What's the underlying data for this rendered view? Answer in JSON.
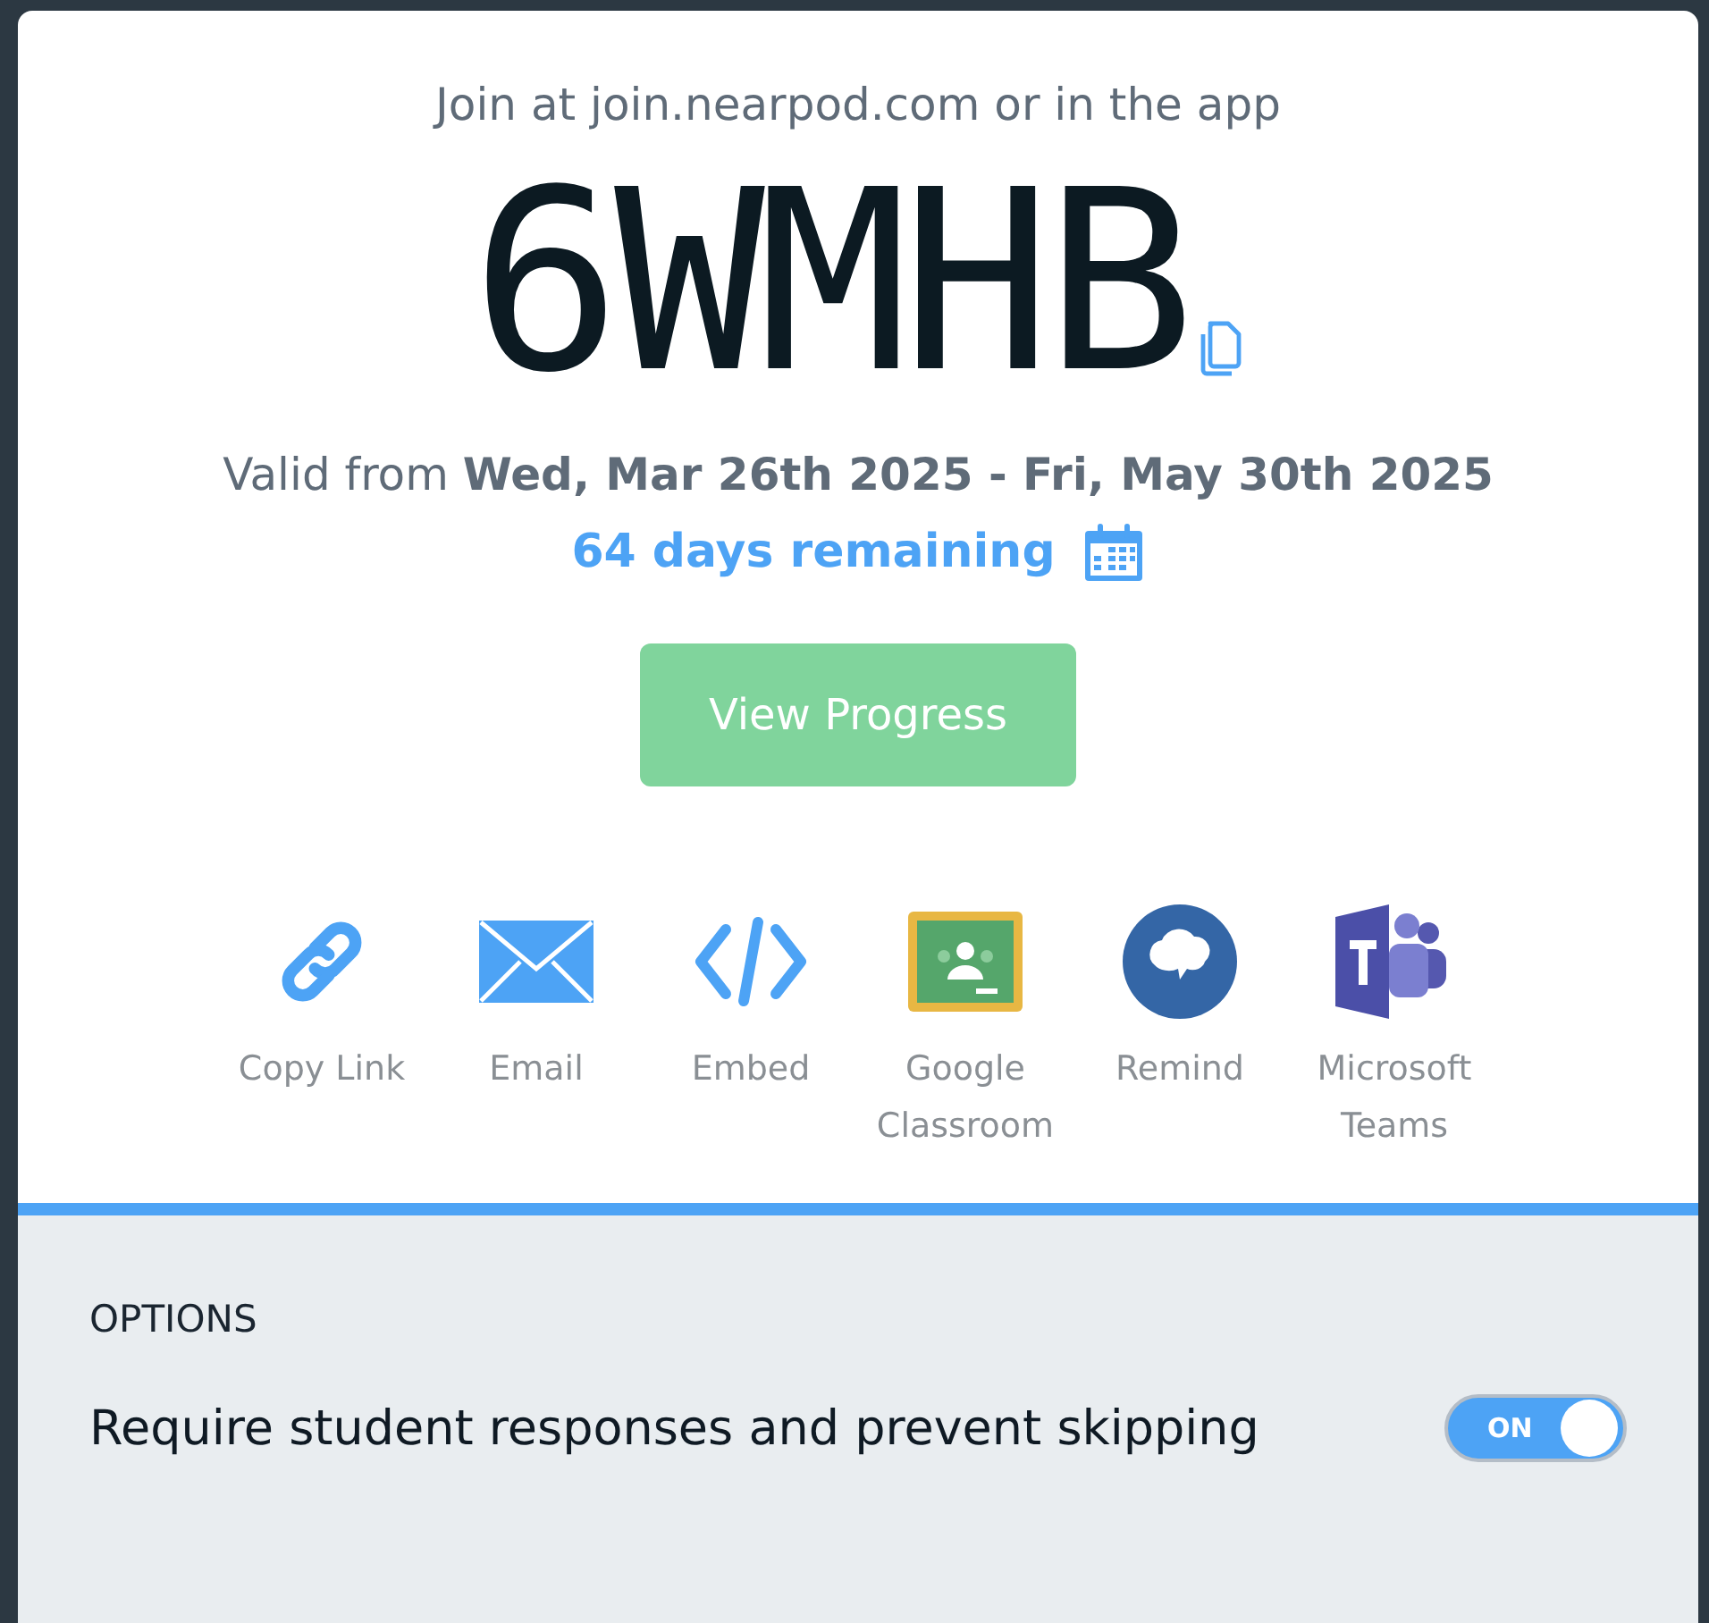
{
  "join_text": "Join at join.nearpod.com or in the app",
  "code": "6WMHB",
  "validity": "Valid from **Wed, Mar 26th 2025 - Fri, May 30th 2025**",
  "remaining": "64 days remaining",
  "primary_button": "View Progress",
  "share_options": [
    {
      "kind": "link",
      "label": "Copy Link"
    },
    {
      "kind": "email",
      "label": "Email"
    },
    {
      "kind": "embed",
      "label": "Embed"
    },
    {
      "kind": "classroom",
      "label": "Google Classroom"
    },
    {
      "kind": "remind",
      "label": "Remind"
    },
    {
      "kind": "teams",
      "label": "Microsoft Teams"
    }
  ],
  "options": {
    "heading": "OPTIONS",
    "items": [
      {
        "label": "Require student responses and prevent skipping",
        "on": true,
        "toggle_text": "ON"
      }
    ]
  }
}
